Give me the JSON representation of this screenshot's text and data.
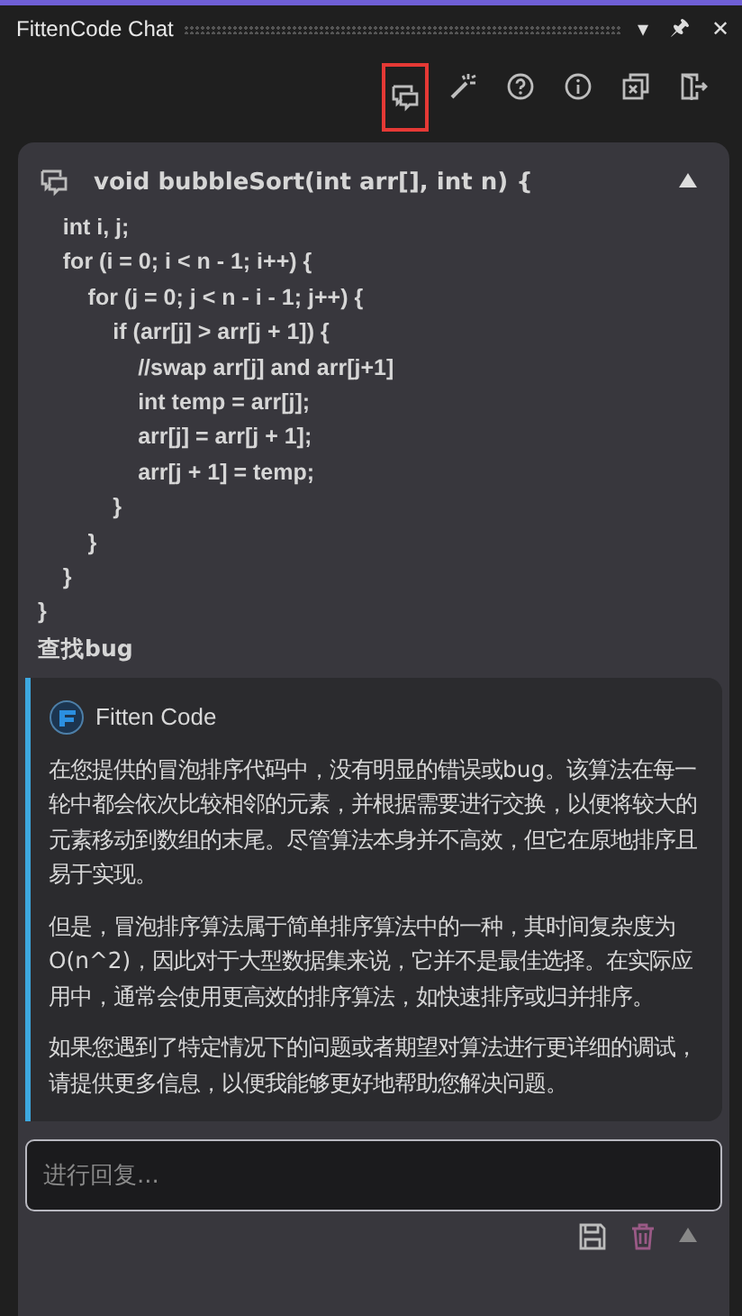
{
  "window": {
    "title": "FittenCode Chat",
    "controls": [
      "▾",
      "🖈",
      "✕"
    ]
  },
  "toolbar": [
    {
      "kind": "chat",
      "highlighted": true
    },
    {
      "kind": "wand",
      "highlighted": false
    },
    {
      "kind": "help",
      "highlighted": false
    },
    {
      "kind": "info",
      "highlighted": false
    },
    {
      "kind": "close-all",
      "highlighted": false
    },
    {
      "kind": "exit",
      "highlighted": false
    }
  ],
  "question": {
    "first_line": "void bubbleSort(int arr[], int n) {",
    "expanded": true,
    "code_lines": [
      "    int i, j;",
      "    for (i = 0; i < n - 1; i++) {",
      "        for (j = 0; j < n - i - 1; j++) {",
      "            if (arr[j] > arr[j + 1]) {",
      "                //swap arr[j] and arr[j+1]",
      "                int temp = arr[j];",
      "                arr[j] = arr[j + 1];",
      "                arr[j + 1] = temp;",
      "            }",
      "        }",
      "    }",
      "}"
    ],
    "prompt": "查找bug"
  },
  "answer": {
    "author": "Fitten Code",
    "paragraphs": [
      "在您提供的冒泡排序代码中，没有明显的错误或bug。该算法在每一轮中都会依次比较相邻的元素，并根据需要进行交换，以便将较大的元素移动到数组的末尾。尽管算法本身并不高效，但它在原地排序且易于实现。",
      "但是，冒泡排序算法属于简单排序算法中的一种，其时间复杂度为O(n^2)，因此对于大型数据集来说，它并不是最佳选择。在实际应用中，通常会使用更高效的排序算法，如快速排序或归并排序。",
      "如果您遇到了特定情况下的问题或者期望对算法进行更详细的调试，请提供更多信息，以便我能够更好地帮助您解决问题。"
    ]
  },
  "reply": {
    "placeholder": "进行回复..."
  }
}
